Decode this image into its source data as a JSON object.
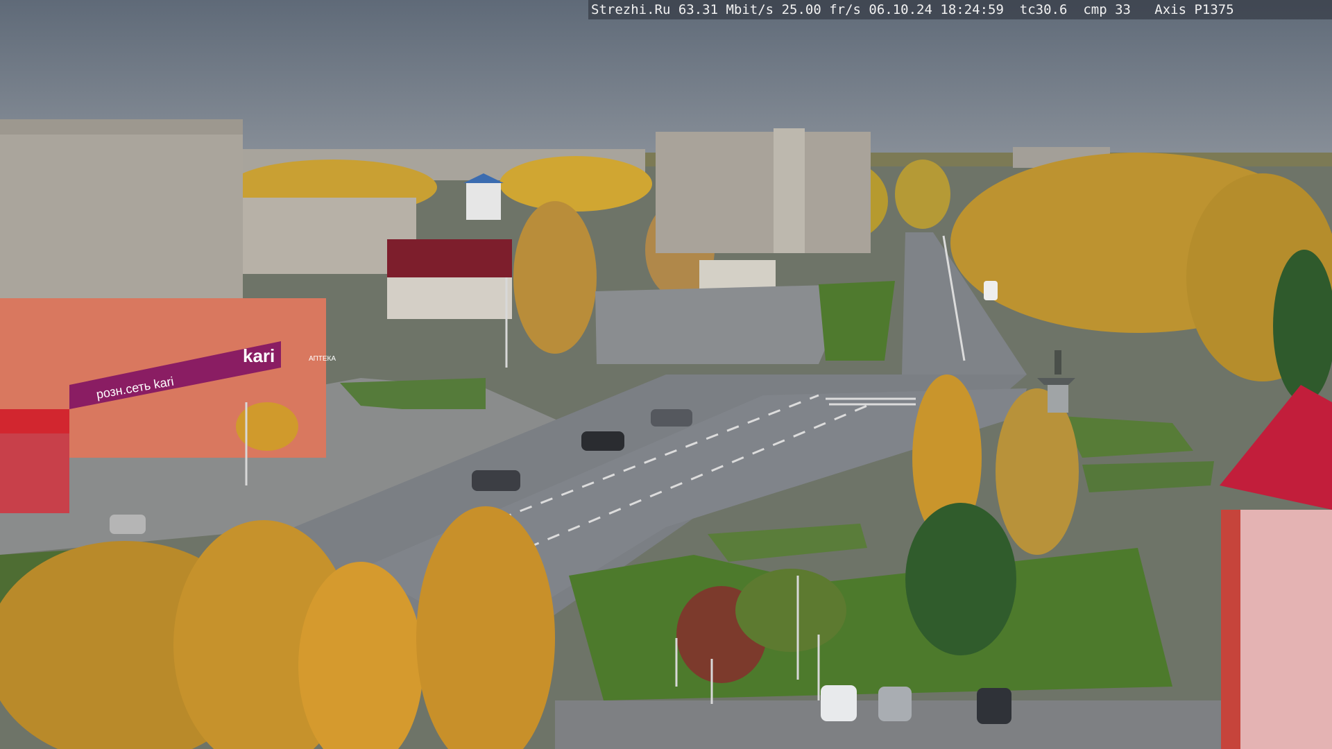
{
  "overlay": {
    "site": "Strezhi.Ru",
    "bitrate": "63.31 Mbit/s",
    "framerate": "25.00 fr/s",
    "date": "06.10.24",
    "time": "18:24:59",
    "tc": "tc30.6",
    "cmp": "cmp 33",
    "camera": "Axis P1375"
  },
  "signs": {
    "store_brand": "kari",
    "store_facade": "розн.сеть kari",
    "pharmacy": "АПТЕКА"
  },
  "colors": {
    "sky": "#66707c",
    "road": "#7d8186",
    "foliage": "#c99a2a",
    "grass": "#4f7a2e",
    "accent_red": "#b3263a",
    "store_purple": "#8a1d63"
  }
}
